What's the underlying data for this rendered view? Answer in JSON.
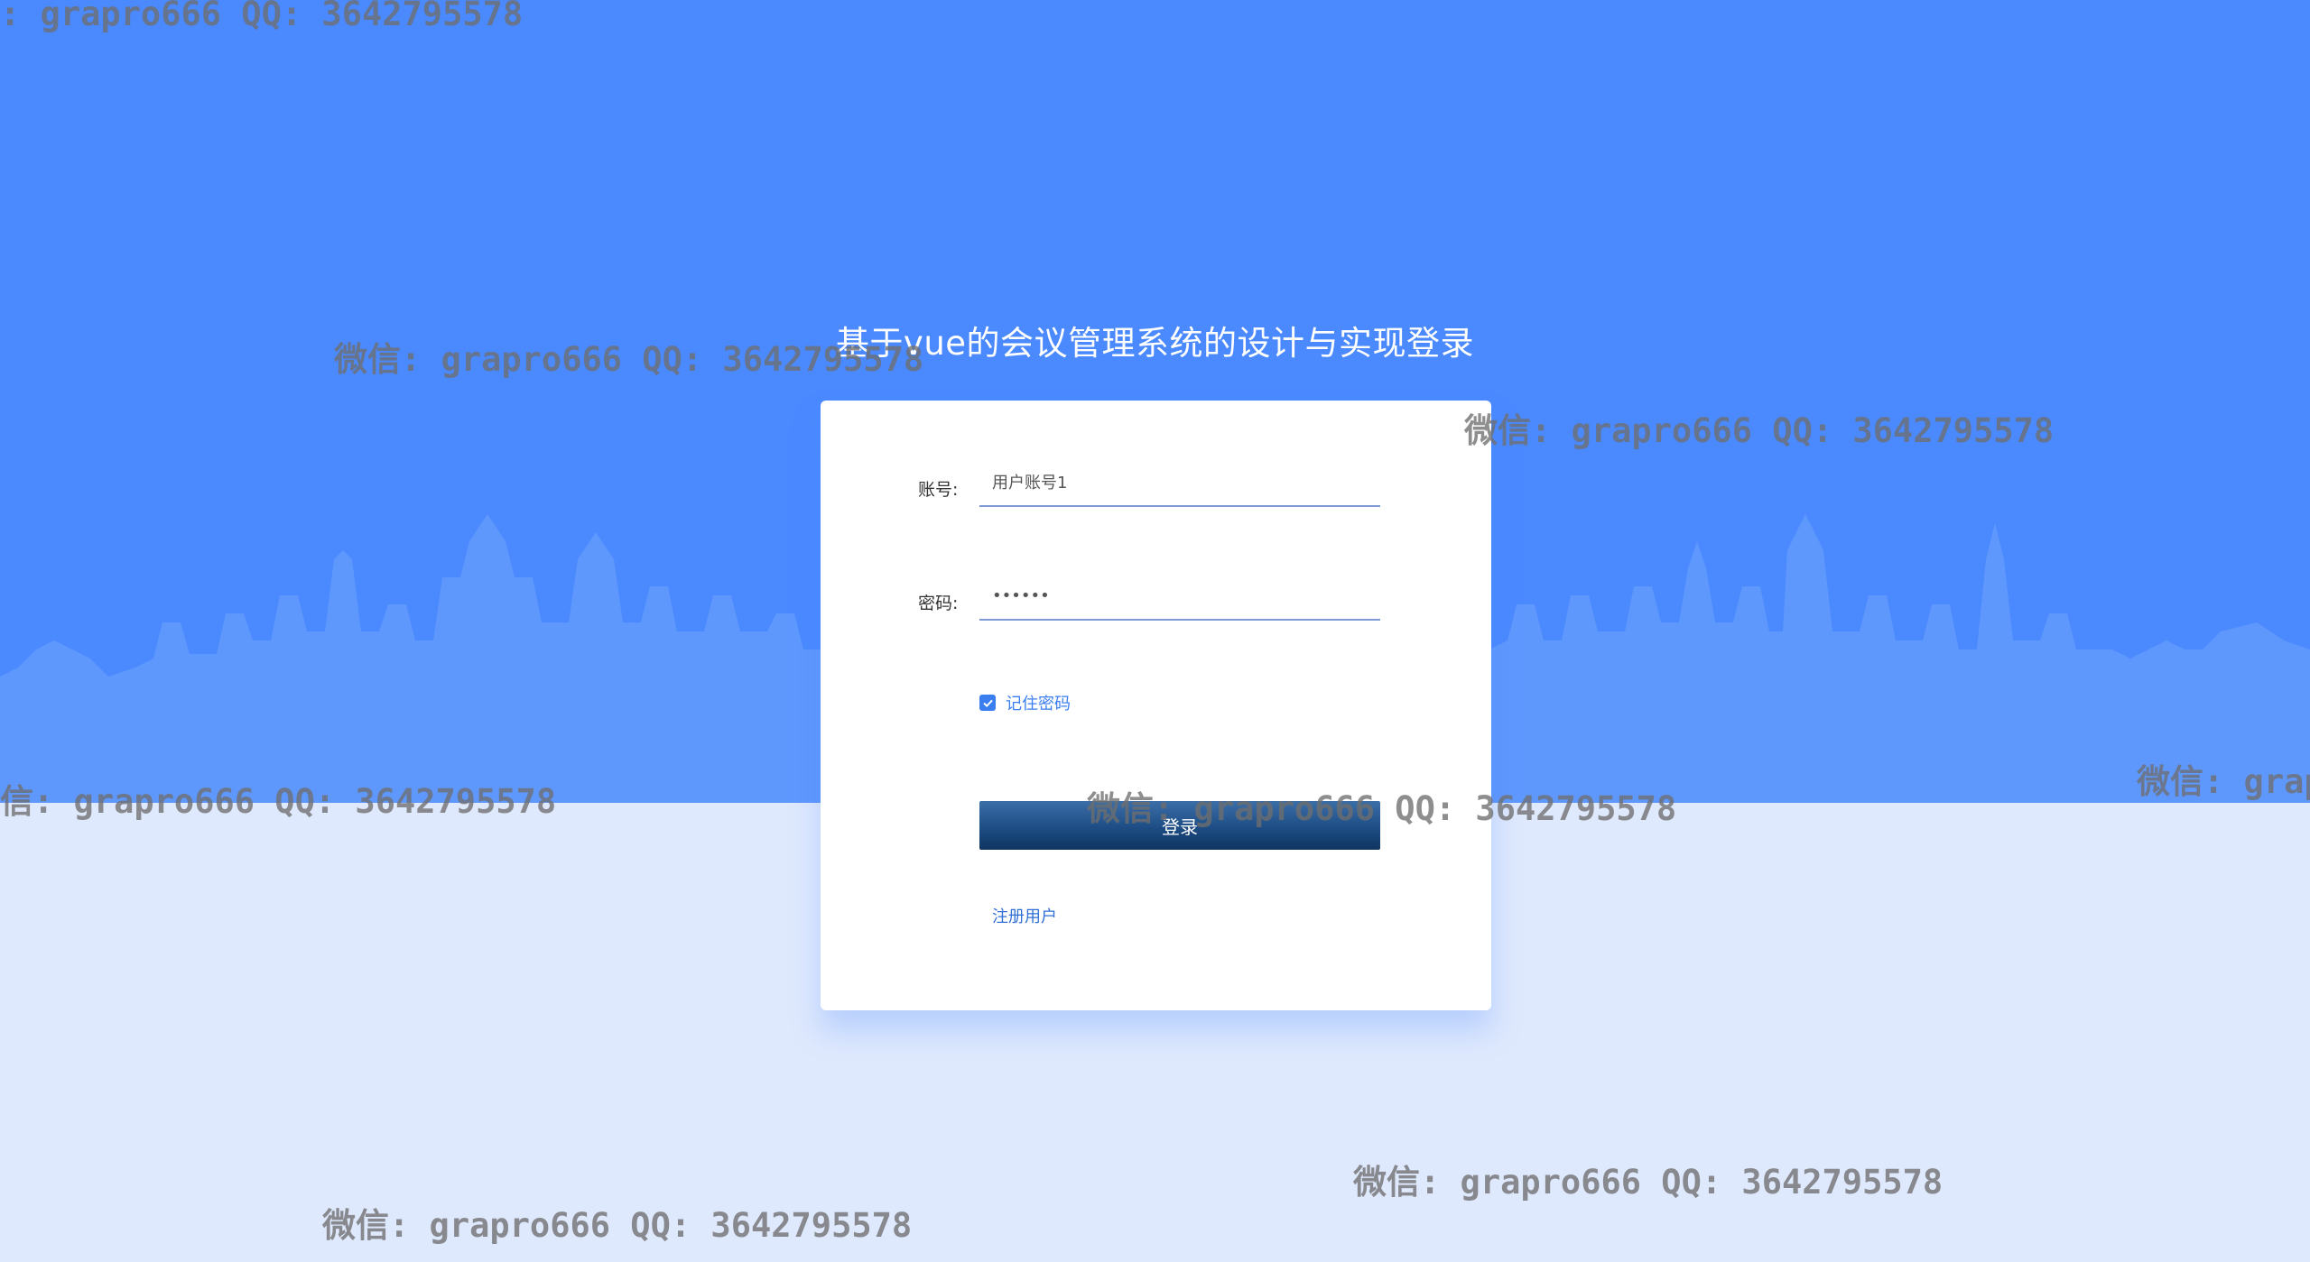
{
  "page": {
    "title": "基于vue的会议管理系统的设计与实现登录"
  },
  "form": {
    "account_label": "账号:",
    "account_value": "用户账号1",
    "password_label": "密码:",
    "password_value": "••••••",
    "remember_label": "记住密码",
    "remember_checked": true,
    "login_button": "登录",
    "register_link": "注册用户"
  },
  "watermark": {
    "text": "微信: grapro666 QQ: 3642795578",
    "partial_left_top": ": grapro666 QQ: 3642795578",
    "partial_left_mid": "信: grapro666 QQ: 3642795578",
    "partial_right": "微信: grap"
  },
  "colors": {
    "sky": "#4a89fe",
    "ground": "#dfe9fd",
    "accent": "#3a7ef0",
    "button": "#1d4d84"
  }
}
